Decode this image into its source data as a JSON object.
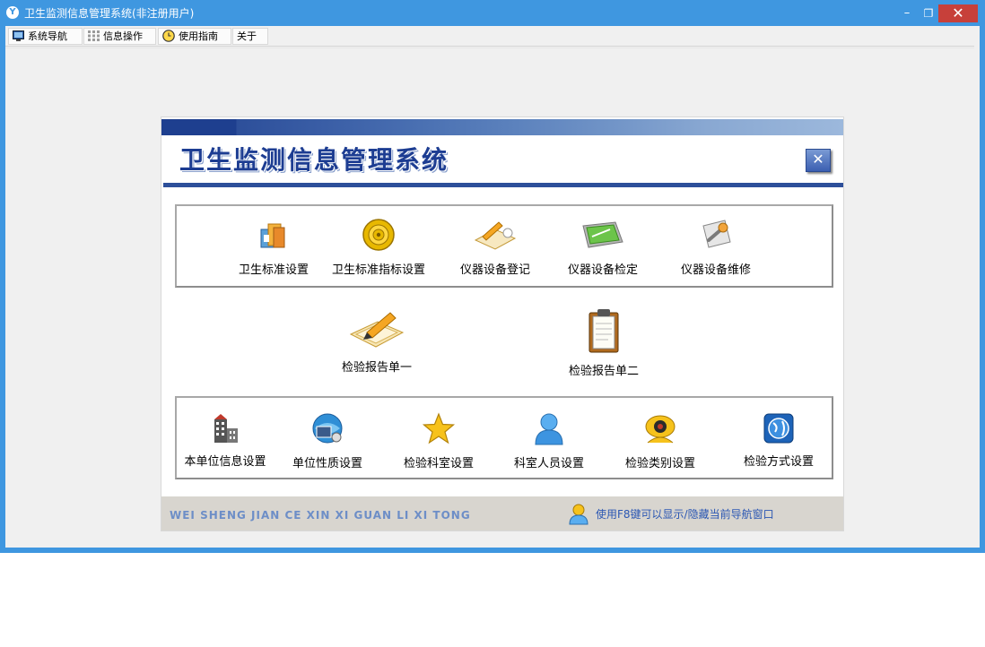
{
  "window": {
    "title": "卫生监测信息管理系统(非注册用户)",
    "app_icon_glyph": "Y"
  },
  "controls": {
    "min": "–",
    "max": "❐",
    "close": "✕"
  },
  "menu": [
    {
      "label": "系统导航",
      "icon": "monitor-icon"
    },
    {
      "label": "信息操作",
      "icon": "grid-icon"
    },
    {
      "label": "使用指南",
      "icon": "clock-icon"
    },
    {
      "label": "关于",
      "icon": ""
    }
  ],
  "nav": {
    "logo": "卫生监测信息管理系统",
    "close_glyph": "✕",
    "group1": [
      {
        "label": "卫生标准设置",
        "icon": "folder-files-icon"
      },
      {
        "label": "卫生标准指标设置",
        "icon": "target-icon"
      },
      {
        "label": "仪器设备登记",
        "icon": "pencil-notebook-icon"
      },
      {
        "label": "仪器设备检定",
        "icon": "screen-icon"
      },
      {
        "label": "仪器设备维修",
        "icon": "wrench-icon"
      }
    ],
    "reports": [
      {
        "label": "检验报告单一",
        "icon": "writing-pad-icon"
      },
      {
        "label": "检验报告单二",
        "icon": "clipboard-icon"
      }
    ],
    "group2": [
      {
        "label": "本单位信息设置",
        "icon": "building-icon"
      },
      {
        "label": "单位性质设置",
        "icon": "globe-network-icon"
      },
      {
        "label": "检验科室设置",
        "icon": "star-icon"
      },
      {
        "label": "科室人员设置",
        "icon": "user-icon"
      },
      {
        "label": "检验类别设置",
        "icon": "eye-icon"
      },
      {
        "label": "检验方式设置",
        "icon": "world-icon"
      }
    ],
    "footer": {
      "pinyin": "WEI SHENG JIAN CE XIN XI GUAN LI XI TONG",
      "hint": "使用F8键可以显示/隐藏当前导航窗口"
    }
  },
  "colors": {
    "title_blue": "#3f97e0",
    "nav_blue": "#2d4f9a",
    "close_red": "#c7403a"
  }
}
